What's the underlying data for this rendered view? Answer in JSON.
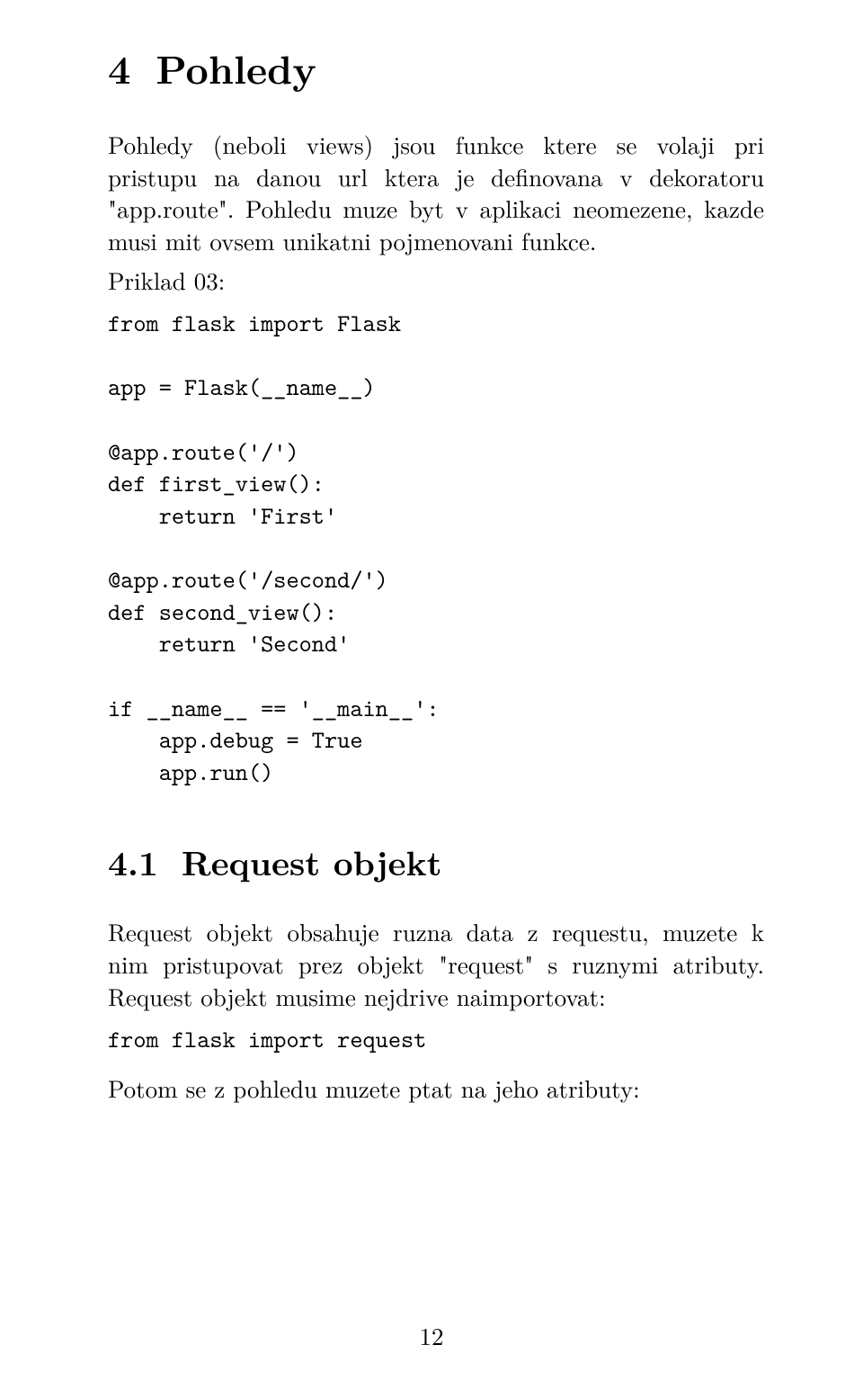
{
  "section": {
    "number": "4",
    "title": "Pohledy"
  },
  "para1": "Pohledy (neboli views) jsou funkce ktere se volaji pri pristupu na danou url ktera je definovana v dekoratoru \"app.route\". Pohledu muze byt v aplikaci neomezene, kazde musi mit ovsem unikatni pojmenovani funkce.",
  "example_label": "Priklad 03:",
  "code": "from flask import Flask\n\napp = Flask(__name__)\n\n@app.route('/')\ndef first_view():\n    return 'First'\n\n@app.route('/second/')\ndef second_view():\n    return 'Second'\n\nif __name__ == '__main__':\n    app.debug = True\n    app.run()",
  "subsection": {
    "number": "4.1",
    "title": "Request objekt"
  },
  "para2": "Request objekt obsahuje ruzna data z requestu, muzete k nim pristupovat prez objekt \"request\" s ruznymi atributy. Request objekt musime nejdrive naimportovat:",
  "code2": "from flask import request",
  "para3": "Potom se z pohledu muzete ptat na jeho atributy:",
  "page_number": "12"
}
